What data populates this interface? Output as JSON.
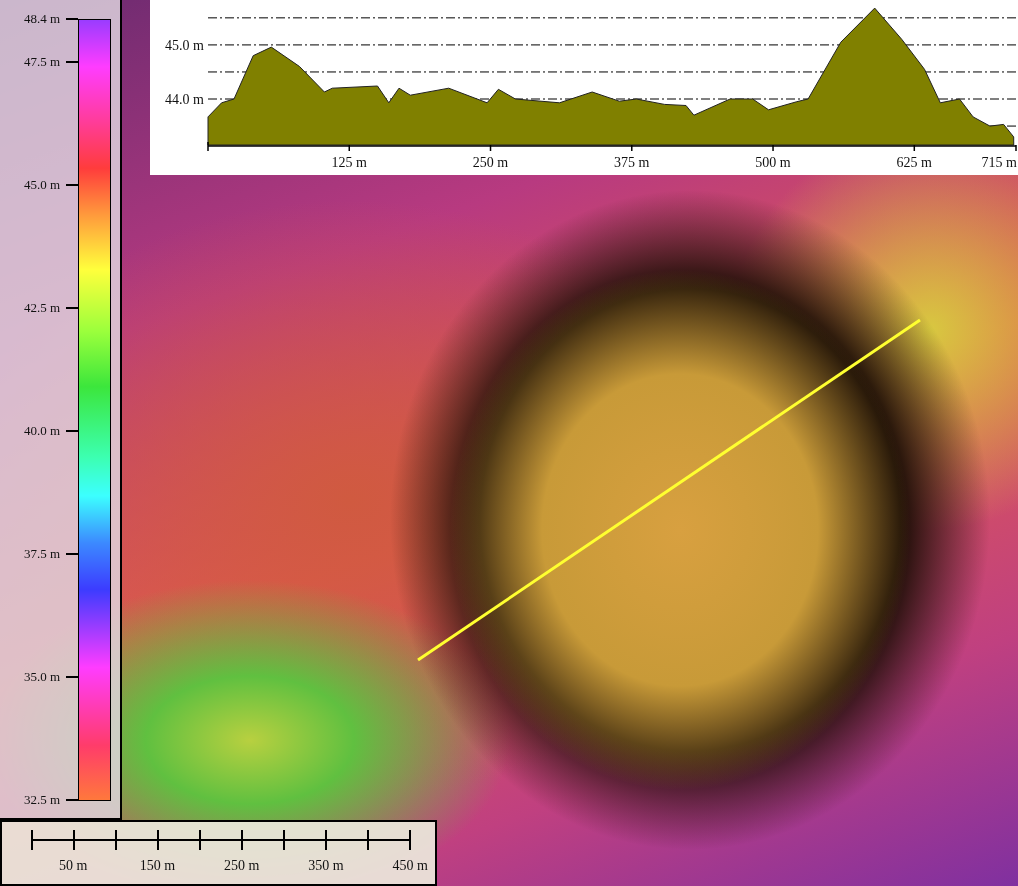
{
  "legend": {
    "ticks": [
      "48.4 m",
      "47.5 m",
      "45.0 m",
      "42.5 m",
      "40.0 m",
      "37.5 m",
      "35.0 m",
      "32.5 m"
    ]
  },
  "profile": {
    "chart_data": {
      "type": "area",
      "xlim": [
        0,
        715
      ],
      "ylim": [
        43.15,
        45.83
      ],
      "x": [
        0,
        12,
        23,
        40,
        56,
        81,
        103,
        110,
        150,
        160,
        169,
        179,
        213,
        247,
        257,
        272,
        311,
        340,
        364,
        379,
        404,
        423,
        430,
        462,
        482,
        496,
        521,
        531,
        560,
        590,
        614,
        634,
        648,
        665,
        677,
        692,
        704,
        713
      ],
      "series": [
        {
          "color": "#808000",
          "values": [
            43.67,
            43.93,
            44.0,
            44.8,
            44.96,
            44.6,
            44.13,
            44.2,
            44.24,
            43.93,
            44.2,
            44.07,
            44.2,
            43.93,
            44.18,
            44.0,
            43.93,
            44.13,
            43.96,
            44.0,
            43.9,
            43.88,
            43.7,
            44.0,
            44.0,
            43.8,
            43.95,
            44.0,
            45.05,
            45.68,
            45.1,
            44.55,
            43.93,
            44.0,
            43.67,
            43.5,
            43.53,
            43.3
          ]
        }
      ],
      "xticks": [
        {
          "value": 125,
          "label": "125 m"
        },
        {
          "value": 250,
          "label": "250 m"
        },
        {
          "value": 375,
          "label": "375 m"
        },
        {
          "value": 500,
          "label": "500 m"
        },
        {
          "value": 625,
          "label": "625 m"
        },
        {
          "value": 715,
          "label": "715 m"
        }
      ],
      "yticks": [
        {
          "value": 44,
          "label": "44.0 m"
        },
        {
          "value": 45,
          "label": "45.0 m"
        }
      ]
    }
  },
  "scale_bar": {
    "labels": [
      "50 m",
      "150 m",
      "250 m",
      "350 m",
      "450 m"
    ]
  }
}
